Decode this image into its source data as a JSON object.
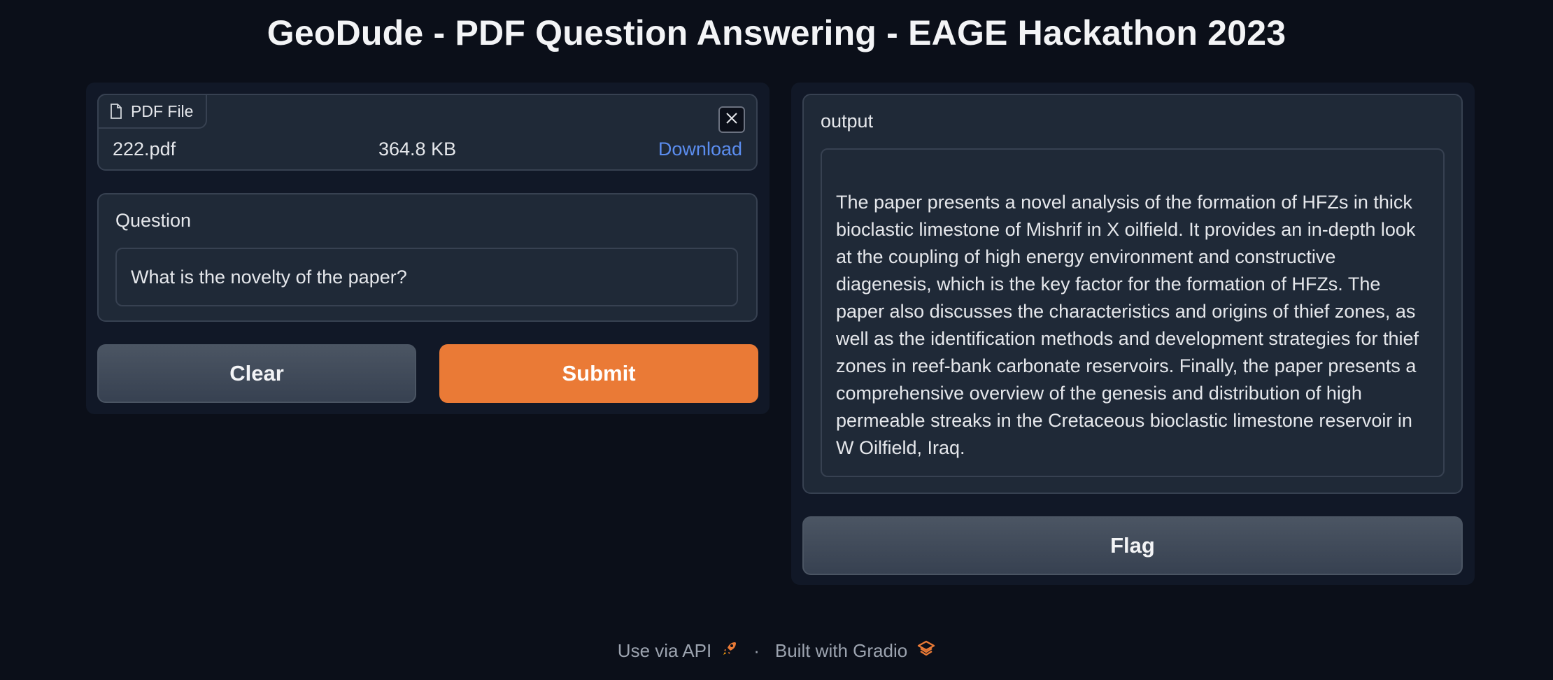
{
  "page_title": "GeoDude - PDF Question Answering - EAGE Hackathon 2023",
  "file_upload": {
    "label": "PDF File",
    "file_name": "222.pdf",
    "file_size": "364.8 KB",
    "download_label": "Download"
  },
  "question": {
    "label": "Question",
    "value": "What is the novelty of the paper?"
  },
  "buttons": {
    "clear": "Clear",
    "submit": "Submit",
    "flag": "Flag"
  },
  "output": {
    "label": "output",
    "text": "The paper presents a novel analysis of the formation of HFZs in thick bioclastic limestone of Mishrif in X oilfield. It provides an in-depth look at the coupling of high energy environment and constructive diagenesis, which is the key factor for the formation of HFZs. The paper also discusses the characteristics and origins of thief zones, as well as the identification methods and development strategies for thief zones in reef-bank carbonate reservoirs. Finally, the paper presents a comprehensive overview of the genesis and distribution of high permeable streaks in the Cretaceous bioclastic limestone reservoir in W Oilfield, Iraq."
  },
  "footer": {
    "api_label": "Use via API",
    "separator": "·",
    "built_label": "Built with Gradio"
  },
  "colors": {
    "accent": "#ea7a36",
    "link": "#5b8def",
    "background": "#0b0f19"
  }
}
